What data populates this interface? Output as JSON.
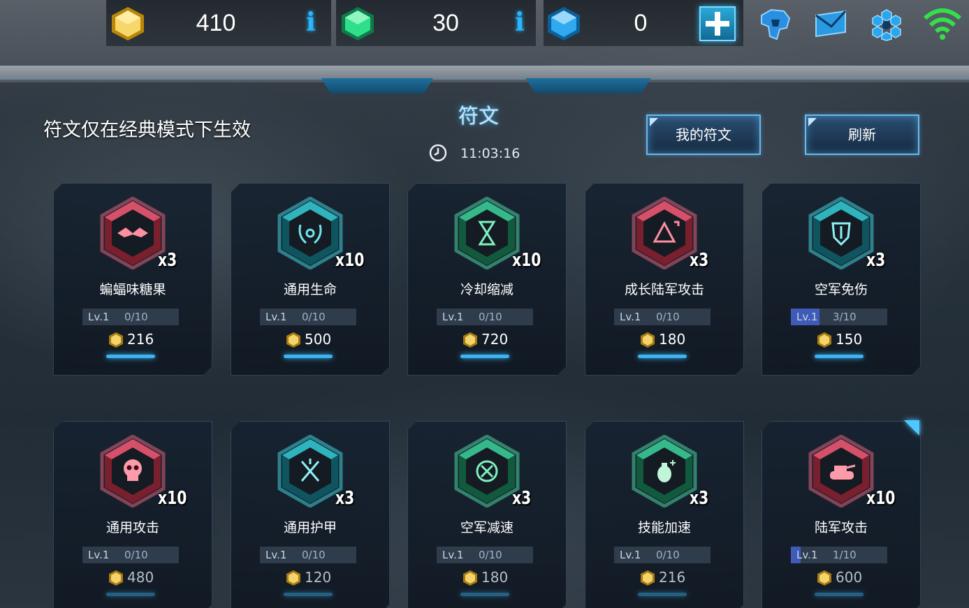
{
  "topbar": {
    "gold": {
      "amount": "410",
      "icon": "gold-hexagon-icon",
      "color": "#f2c94c"
    },
    "crystal": {
      "amount": "30",
      "icon": "green-gem-icon",
      "color": "#2ee08a"
    },
    "diamond": {
      "amount": "0",
      "icon": "blue-gem-icon",
      "color": "#2fa9f0"
    },
    "icons": [
      "add-icon",
      "helmet-icon",
      "mail-icon",
      "settings-icon",
      "wifi-icon"
    ]
  },
  "header": {
    "notice": "符文仅在经典模式下生效",
    "title": "符文",
    "timer": "11:03:16",
    "my_runes_label": "我的符文",
    "refresh_label": "刷新"
  },
  "colors": {
    "red": "#c0233f",
    "teal": "#1aa7b3",
    "green": "#1fae78",
    "accent": "#3db4f2"
  },
  "cards": [
    {
      "name": "蝙蝠味糖果",
      "qty": "x3",
      "lv": "Lv.1",
      "progress": "0/10",
      "progress_fraction": 0,
      "cost": "216",
      "color": "red",
      "icon": "bat-icon"
    },
    {
      "name": "通用生命",
      "qty": "x10",
      "lv": "Lv.1",
      "progress": "0/10",
      "progress_fraction": 0,
      "cost": "500",
      "color": "teal",
      "icon": "laurel-wreath-icon"
    },
    {
      "name": "冷却缩减",
      "qty": "x10",
      "lv": "Lv.1",
      "progress": "0/10",
      "progress_fraction": 0,
      "cost": "720",
      "color": "green",
      "icon": "hourglass-icon"
    },
    {
      "name": "成长陆军攻击",
      "qty": "x3",
      "lv": "Lv.1",
      "progress": "0/10",
      "progress_fraction": 0,
      "cost": "180",
      "color": "red",
      "icon": "army-growth-icon"
    },
    {
      "name": "空军免伤",
      "qty": "x3",
      "lv": "Lv.1",
      "progress": "3/10",
      "progress_fraction": 0.3,
      "cost": "150",
      "color": "teal",
      "icon": "air-shield-icon"
    },
    {
      "name": "通用攻击",
      "qty": "x10",
      "lv": "Lv.1",
      "progress": "0/10",
      "progress_fraction": 0,
      "cost": "480",
      "color": "red",
      "icon": "skull-icon"
    },
    {
      "name": "通用护甲",
      "qty": "x3",
      "lv": "Lv.1",
      "progress": "0/10",
      "progress_fraction": 0,
      "cost": "120",
      "color": "teal",
      "icon": "crossed-swords-icon"
    },
    {
      "name": "空军减速",
      "qty": "x3",
      "lv": "Lv.1",
      "progress": "0/10",
      "progress_fraction": 0,
      "cost": "180",
      "color": "green",
      "icon": "slow-icon"
    },
    {
      "name": "技能加速",
      "qty": "x3",
      "lv": "Lv.1",
      "progress": "0/10",
      "progress_fraction": 0,
      "cost": "216",
      "color": "green",
      "icon": "grenade-icon"
    },
    {
      "name": "陆军攻击",
      "qty": "x10",
      "lv": "Lv.1",
      "progress": "1/10",
      "progress_fraction": 0.1,
      "cost": "600",
      "color": "red",
      "icon": "tank-icon"
    }
  ]
}
